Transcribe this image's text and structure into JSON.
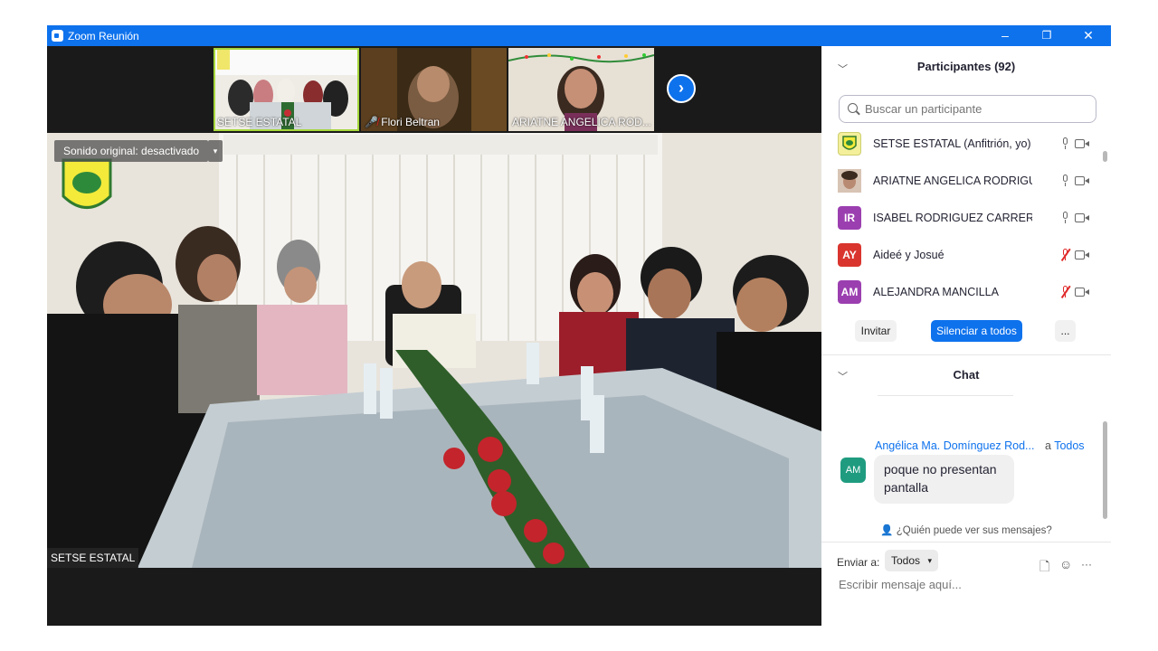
{
  "window": {
    "title": "Zoom Reunión",
    "controls": {
      "minimize": "–",
      "restore": "❐",
      "close": "✕"
    }
  },
  "video": {
    "thumbnails": [
      {
        "name": "SETSE ESTATAL",
        "active": true,
        "muted": false
      },
      {
        "name": "Flori Beltran",
        "active": false,
        "muted": true
      },
      {
        "name": "ARIATNE ANGELICA ROD...",
        "active": false,
        "muted": false
      }
    ],
    "next_icon": "chevron-right-icon",
    "sound_badge": "Sonido original: desactivado",
    "sound_caret": "▾",
    "main_speaker_name": "SETSE ESTATAL"
  },
  "participants": {
    "header": "Participantes (92)",
    "collapse_icon": "chevron-down-icon",
    "search_placeholder": "Buscar un participante",
    "list": [
      {
        "name": "SETSE ESTATAL (Anfitrión, yo)",
        "initials": "",
        "avatar": "logo",
        "avatar_color": "#f3ef9a",
        "muted": false
      },
      {
        "name": "ARIATNE ANGELICA RODRIGUE...",
        "initials": "",
        "avatar": "photo",
        "avatar_color": "#c9a08d",
        "muted": false
      },
      {
        "name": "ISABEL RODRIGUEZ CARRERA",
        "initials": "IR",
        "avatar": "initials",
        "avatar_color": "#9b3fb0",
        "muted": false
      },
      {
        "name": "Aideé y Josué",
        "initials": "AY",
        "avatar": "initials",
        "avatar_color": "#d9352e",
        "muted": true
      },
      {
        "name": "ALEJANDRA MANCILLA",
        "initials": "AM",
        "avatar": "initials",
        "avatar_color": "#9b3fb0",
        "muted": true
      }
    ],
    "buttons": {
      "invite": "Invitar",
      "mute_all": "Silenciar a todos",
      "more": "..."
    }
  },
  "chat": {
    "header": "Chat",
    "message": {
      "sender": "Angélica Ma. Domínguez Rod...",
      "to_prefix": "a",
      "to": "Todos",
      "initials": "AM",
      "text": "poque no presentan pantalla"
    },
    "who_can_see": "¿Quién puede ver sus mensajes?",
    "send_to_label": "Enviar a:",
    "send_to_value": "Todos",
    "input_placeholder": "Escribir mensaje aquí...",
    "toolbar_icons": [
      "file-icon",
      "emoji-icon",
      "more-icon"
    ],
    "more_label": "···"
  },
  "colors": {
    "accent": "#0e72ed",
    "mute_red": "#e02828",
    "dark_bg": "#1a1a1a"
  }
}
